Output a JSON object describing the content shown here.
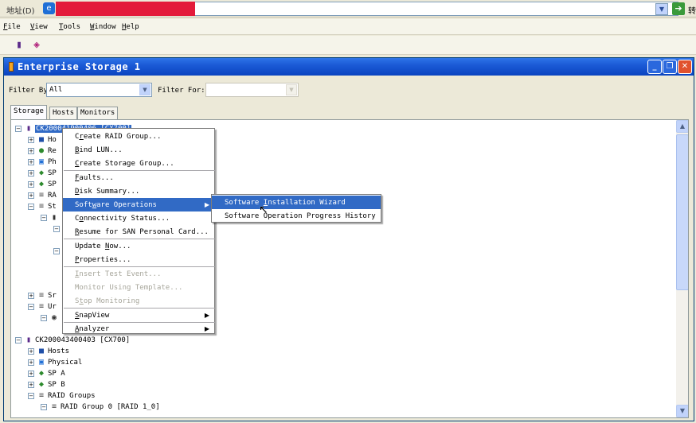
{
  "browser": {
    "address_label": "地址(D)",
    "go_label": "转"
  },
  "menubar": {
    "items": [
      "File",
      "View",
      "Tools",
      "Window",
      "Help"
    ]
  },
  "window": {
    "title": "Enterprise Storage 1",
    "filter_by_label": "Filter By:",
    "filter_by_value": "All",
    "filter_for_label": "Filter For:",
    "filter_for_value": ""
  },
  "tabs": [
    "Storage",
    "Hosts",
    "Monitors"
  ],
  "tree": {
    "rows": [
      {
        "text": "CK200041900406 [CX700]",
        "selected": true
      },
      {
        "text": "Ho"
      },
      {
        "text": "Re"
      },
      {
        "text": "Ph"
      },
      {
        "text": "SP"
      },
      {
        "text": "SP"
      },
      {
        "text": "RA"
      },
      {
        "text": "St"
      },
      {
        "text": "Sr"
      },
      {
        "text": "Ur"
      },
      {
        "text": "CK200043400403 [CX700]"
      },
      {
        "text": "Hosts"
      },
      {
        "text": "Physical"
      },
      {
        "text": "SP A"
      },
      {
        "text": "SP B"
      },
      {
        "text": "RAID Groups"
      },
      {
        "text": "RAID Group 0 [RAID 1_0]"
      }
    ]
  },
  "context_menu": {
    "items": [
      {
        "pre": "C",
        "ul": "r",
        "post": "eate RAID Group..."
      },
      {
        "pre": "",
        "ul": "B",
        "post": "ind LUN..."
      },
      {
        "pre": "",
        "ul": "C",
        "post": "reate Storage Group..."
      },
      {
        "pre": "",
        "ul": "F",
        "post": "aults..."
      },
      {
        "pre": "",
        "ul": "D",
        "post": "isk Summary..."
      },
      {
        "pre": "Soft",
        "ul": "w",
        "post": "are Operations"
      },
      {
        "pre": "C",
        "ul": "o",
        "post": "nnectivity Status..."
      },
      {
        "pre": "",
        "ul": "R",
        "post": "esume for SAN Personal Card..."
      },
      {
        "pre": "Update ",
        "ul": "N",
        "post": "ow..."
      },
      {
        "pre": "",
        "ul": "P",
        "post": "roperties..."
      },
      {
        "pre": "",
        "ul": "I",
        "post": "nsert Test Event..."
      },
      {
        "pre": "Monitor Using Template...",
        "ul": "",
        "post": ""
      },
      {
        "pre": "S",
        "ul": "t",
        "post": "op Monitoring"
      },
      {
        "pre": "",
        "ul": "S",
        "post": "napView"
      },
      {
        "pre": "",
        "ul": "A",
        "post": "nalyzer"
      }
    ]
  },
  "submenu": {
    "items": [
      {
        "pre": "Software ",
        "ul": "I",
        "post": "nstallation Wizard"
      },
      {
        "pre": "Software Operation Progress History",
        "ul": "",
        "post": ""
      }
    ]
  },
  "icons": {
    "browser": "ie-icon",
    "go": "go-arrow-icon",
    "toolbar": [
      "storage-system-icon",
      "wrench-icon"
    ],
    "window": "storage-window-icon"
  },
  "colors": {
    "title_bar": "#0a44c0",
    "selection": "#316ac5",
    "redaction": "#e31b3a"
  }
}
